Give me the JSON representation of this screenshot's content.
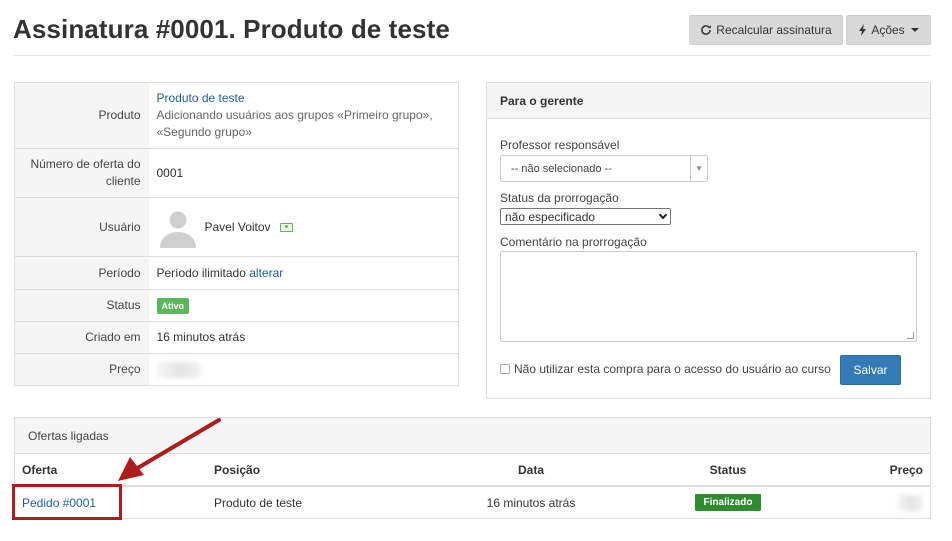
{
  "header": {
    "title": "Assinatura #0001. Produto de teste",
    "recalc_label": "Recalcular assinatura",
    "actions_label": "Ações"
  },
  "details": {
    "produto_label": "Produto",
    "produto_link": "Produto de teste",
    "produto_desc": "Adicionando usuários aos grupos «Primeiro grupo», «Segundo grupo»",
    "numero_label": "Número de oferta do cliente",
    "numero_value": "0001",
    "usuario_label": "Usuário",
    "usuario_name": "Pavel Voitov",
    "periodo_label": "Período",
    "periodo_value": "Período ilimitado",
    "periodo_link": "alterar",
    "status_label": "Status",
    "status_badge": "Ativo",
    "criado_label": "Criado em",
    "criado_value": "16 minutos atrás",
    "preco_label": "Preço"
  },
  "manager": {
    "heading": "Para o gerente",
    "teacher_label": "Professor responsável",
    "teacher_value": "-- não selecionado --",
    "ext_status_label": "Status da prorrogação",
    "ext_status_value": "não especificado",
    "comment_label": "Comentário na prorrogação",
    "checkbox_label": "Não utilizar esta compra para o acesso do usuário ao curso",
    "save_label": "Salvar"
  },
  "offers": {
    "heading": "Ofertas ligadas",
    "columns": {
      "oferta": "Oferta",
      "posicao": "Posição",
      "data": "Data",
      "status": "Status",
      "preco": "Preço"
    },
    "rows": [
      {
        "oferta": "Pedido #0001",
        "posicao": "Produto de teste",
        "data": "16 minutos atrás",
        "status": "Finalizado"
      }
    ]
  },
  "colors": {
    "primary": "#337ab7",
    "success": "#5cb85c",
    "finalizado": "#2e8b2e",
    "annotation": "#b01c1c",
    "link": "#1f5e9a"
  }
}
